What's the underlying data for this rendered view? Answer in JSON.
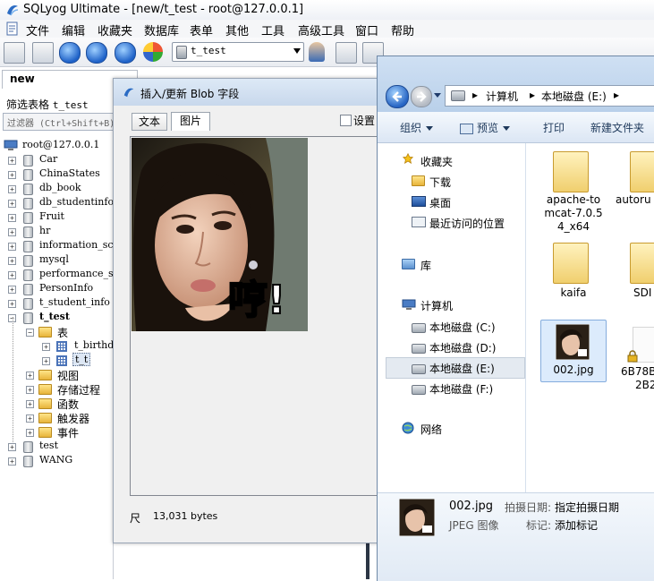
{
  "app": {
    "title": "SQLyog Ultimate - [new/t_test - root@127.0.0.1]"
  },
  "menu": [
    "文件",
    "编辑",
    "收藏夹",
    "数据库",
    "表单",
    "其他",
    "工具",
    "高级工具",
    "窗口",
    "帮助"
  ],
  "toolbar": {
    "database_select": "t_test"
  },
  "connection_tab": "new",
  "filter": {
    "label_prefix": "筛选表格",
    "label_value": "t_test",
    "placeholder": "过滤器 (Ctrl+Shift+B)"
  },
  "tree": {
    "root": "root@127.0.0.1",
    "databases": [
      "Car",
      "ChinaStates",
      "db_book",
      "db_studentinfo",
      "Fruit",
      "hr",
      "information_schema",
      "mysql",
      "performance_schema",
      "PersonInfo",
      "t_student_info"
    ],
    "open_db": "t_test",
    "tables_folder": "表",
    "tables": [
      "t_birthday",
      "t_t"
    ],
    "folders": [
      "视图",
      "存储过程",
      "函数",
      "触发器",
      "事件"
    ],
    "after": [
      "test",
      "WANG"
    ]
  },
  "blob_dialog": {
    "title": "插入/更新 Blob 字段",
    "tab_text": "文本",
    "tab_image": "图片",
    "setting_label": "设置",
    "image_caption": "哼!",
    "size_icon": "尺",
    "size": "13,031 bytes"
  },
  "explorer": {
    "breadcrumb": [
      "计算机",
      "本地磁盘 (E:)"
    ],
    "commands": [
      "组织",
      "预览",
      "打印",
      "新建文件夹"
    ],
    "nav": {
      "favorites": "收藏夹",
      "favorites_items": [
        "下载",
        "桌面",
        "最近访问的位置"
      ],
      "library": "库",
      "computer": "计算机",
      "drives": [
        "本地磁盘 (C:)",
        "本地磁盘 (D:)",
        "本地磁盘 (E:)",
        "本地磁盘 (F:)"
      ],
      "network": "网络"
    },
    "files": {
      "f1_line1": "apache-to",
      "f1_line2": "mcat-7.0.5",
      "f1_line3": "4_x64",
      "f2": "autoru",
      "f3": "kaifa",
      "f4": "SDI",
      "f5": "002.jpg",
      "f6_line1": "6B78B",
      "f6_line2": "2B2"
    },
    "details": {
      "filename": "002.jpg",
      "type": "JPEG 图像",
      "date_label": "拍摄日期:",
      "date_value": "指定拍摄日期",
      "tags_label": "标记:",
      "tags_value": "添加标记"
    }
  },
  "colors": {
    "accent_blue": "#2765c4",
    "title_gradient": "#c8d8ec"
  }
}
